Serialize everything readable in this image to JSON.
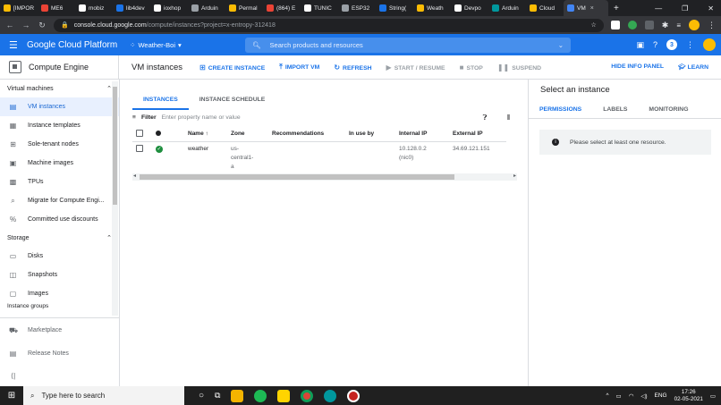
{
  "browser": {
    "tabs": [
      {
        "label": "[IMPOR",
        "color": "#fbbc04"
      },
      {
        "label": "ME6",
        "color": "#ea4335"
      },
      {
        "label": "mobiz",
        "color": "#ffffff"
      },
      {
        "label": "lib4dev",
        "color": "#1a73e8"
      },
      {
        "label": "ioxhop",
        "color": "#ffffff"
      },
      {
        "label": "Arduin",
        "color": "#9aa0a6"
      },
      {
        "label": "Permal",
        "color": "#fbbc04"
      },
      {
        "label": "(864) E",
        "color": "#ea4335"
      },
      {
        "label": "TUNIC",
        "color": "#ffffff"
      },
      {
        "label": "ESP32",
        "color": "#9aa0a6"
      },
      {
        "label": "String(",
        "color": "#1a73e8"
      },
      {
        "label": "Weath",
        "color": "#fbbc04"
      },
      {
        "label": "Devpo",
        "color": "#ffffff"
      },
      {
        "label": "Arduin",
        "color": "#00979d"
      },
      {
        "label": "Cloud",
        "color": "#fbbc04"
      },
      {
        "label": "VM",
        "color": "#4285f4",
        "active": true
      }
    ],
    "new_tab": "+",
    "url_host": "console.cloud.google.com",
    "url_path": "/compute/instances?project=x-entropy-312418"
  },
  "gcp": {
    "brand": "Google Cloud Platform",
    "project": "Weather-Boi",
    "search_placeholder": "Search products and resources",
    "notifications_count": "3"
  },
  "subheader": {
    "product": "Compute Engine",
    "page_title": "VM instances",
    "actions": {
      "create": "CREATE INSTANCE",
      "import": "IMPORT VM",
      "refresh": "REFRESH",
      "start": "START / RESUME",
      "stop": "STOP",
      "suspend": "SUSPEND",
      "hide_info": "HIDE INFO PANEL",
      "learn": "LEARN"
    }
  },
  "nav": {
    "section_vm": "Virtual machines",
    "vm_items": [
      "VM instances",
      "Instance templates",
      "Sole-tenant nodes",
      "Machine images",
      "TPUs",
      "Migrate for Compute Engi...",
      "Committed use discounts"
    ],
    "section_storage": "Storage",
    "storage_items": [
      "Disks",
      "Snapshots",
      "Images"
    ],
    "section_groups_partial": "Instance groups",
    "marketplace": "Marketplace",
    "release_notes": "Release Notes"
  },
  "main": {
    "tabs": [
      "INSTANCES",
      "INSTANCE SCHEDULE"
    ],
    "filter_label": "Filter",
    "filter_placeholder": "Enter property name or value",
    "columns": [
      "Name",
      "Zone",
      "Recommendations",
      "In use by",
      "Internal IP",
      "External IP"
    ],
    "rows": [
      {
        "name": "weather",
        "zone_l1": "us-",
        "zone_l2": "central1-",
        "zone_l3": "a",
        "recommendations": "",
        "in_use_by": "",
        "internal_ip": "10.128.0.2",
        "internal_nic": "(nic0)",
        "external_ip": "34.69.121.151"
      }
    ]
  },
  "info_panel": {
    "title": "Select an instance",
    "tabs": [
      "PERMISSIONS",
      "LABELS",
      "MONITORING"
    ],
    "notice": "Please select at least one resource."
  },
  "taskbar": {
    "search_placeholder": "Type here to search",
    "lang": "ENG",
    "time": "17:26",
    "date": "02-05-2021"
  }
}
